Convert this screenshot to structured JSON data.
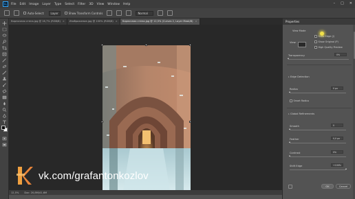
{
  "menubar": {
    "logo": "Ps",
    "items": [
      "File",
      "Edit",
      "Image",
      "Layer",
      "Type",
      "Select",
      "Filter",
      "3D",
      "View",
      "Window",
      "Help"
    ],
    "window_buttons": [
      "–",
      "□",
      "✕"
    ]
  },
  "options": {
    "auto_select": "Auto-Select:",
    "layer_select": "Layer",
    "show_transform": "Show Transform Controls",
    "mode": "Normal"
  },
  "tabs": [
    {
      "label": "Кирпичная стена.jpg @ 16,7% (RGB/8)",
      "close": "×"
    },
    {
      "label": "Изображение.jpg @ 100% (RGB/8)",
      "close": "×"
    },
    {
      "label": "Кирпичная стена.jpg @ 12,5% (Curves 2, Layer Mask/8)",
      "close": "×"
    }
  ],
  "status": {
    "zoom": "12,5%",
    "doc_info": "Doc: 20,8M/41,6M"
  },
  "watermark": {
    "text": "vk.com/grafantonkozlov"
  },
  "properties": {
    "tab_label": "Properties",
    "view_mode_label": "View Mode",
    "view_label": "View:",
    "show_edge": "Show Edge (J)",
    "show_original": "Show Original (P)",
    "high_quality": "High Quality Preview",
    "transparency_label": "Transparency",
    "transparency_value": "0%",
    "transparency_fraction": 0.0,
    "edge_detection": "Edge Detection",
    "radius_label": "Radius",
    "radius_value": "0 px",
    "radius_fraction": 0.0,
    "smart_radius": "Smart Radius",
    "global_refinements": "Global Refinements",
    "smooth_label": "Smooth",
    "smooth_value": "0",
    "smooth_fraction": 0.0,
    "feather_label": "Feather",
    "feather_value": "0,0 px",
    "feather_fraction": 0.0,
    "contrast_label": "Contrast",
    "contrast_value": "0%",
    "contrast_fraction": 0.0,
    "shift_edge_label": "Shift Edge",
    "shift_edge_value": "+100%",
    "shift_edge_fraction": 1.0,
    "ok_label": "OK",
    "cancel_label": "Cancel"
  }
}
